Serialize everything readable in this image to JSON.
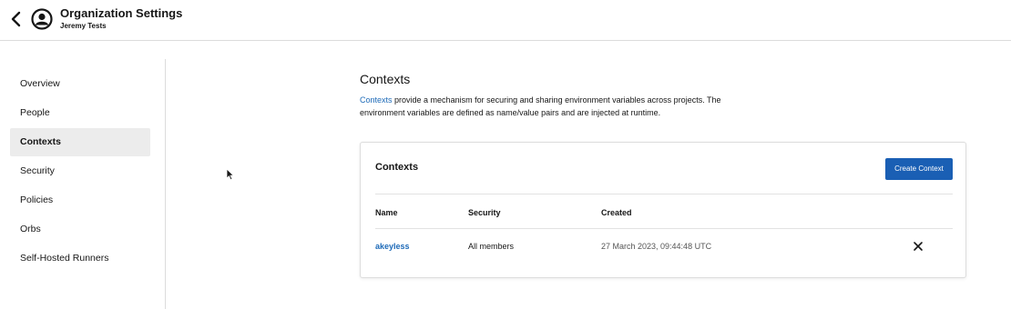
{
  "header": {
    "title": "Organization Settings",
    "subtitle": "Jeremy Tests"
  },
  "sidebar": {
    "items": [
      {
        "label": "Overview",
        "active": false
      },
      {
        "label": "People",
        "active": false
      },
      {
        "label": "Contexts",
        "active": true
      },
      {
        "label": "Security",
        "active": false
      },
      {
        "label": "Policies",
        "active": false
      },
      {
        "label": "Orbs",
        "active": false
      },
      {
        "label": "Self-Hosted Runners",
        "active": false
      }
    ]
  },
  "main": {
    "title": "Contexts",
    "description_link": "Contexts",
    "description_text": " provide a mechanism for securing and sharing environment variables across projects. The environment variables are defined as name/value pairs and are injected at runtime."
  },
  "card": {
    "title": "Contexts",
    "create_button": "Create Context",
    "columns": [
      "Name",
      "Security",
      "Created"
    ],
    "rows": [
      {
        "name": "akeyless",
        "security": "All members",
        "created": "27 March 2023, 09:44:48 UTC"
      }
    ]
  },
  "colors": {
    "accent": "#1a5fb4",
    "link": "#1d6ab8",
    "active_nav_bg": "#ececec"
  }
}
